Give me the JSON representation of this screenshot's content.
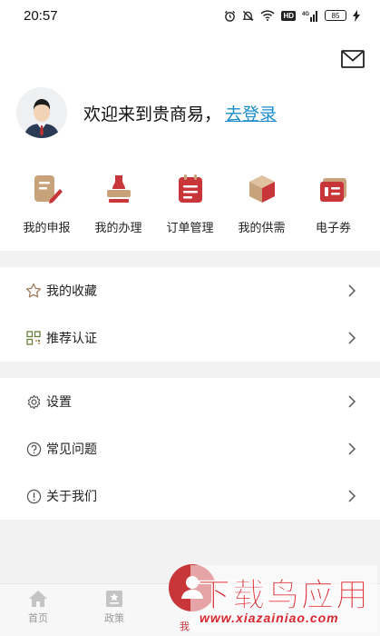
{
  "status_bar": {
    "time": "20:57",
    "hd": "HD",
    "signal": "4G",
    "battery": "85"
  },
  "header": {
    "welcome_text": "欢迎来到贵商易，",
    "login_link": "去登录",
    "mail_icon": "mail-icon",
    "avatar": "avatar-man-icon"
  },
  "quick_actions": [
    {
      "label": "我的申报",
      "icon": "document-edit-icon"
    },
    {
      "label": "我的办理",
      "icon": "stamp-icon"
    },
    {
      "label": "订单管理",
      "icon": "order-list-icon"
    },
    {
      "label": "我的供需",
      "icon": "box-icon"
    },
    {
      "label": "电子券",
      "icon": "ticket-icon"
    }
  ],
  "menu_group_1": [
    {
      "label": "我的收藏",
      "icon": "star-icon"
    },
    {
      "label": "推荐认证",
      "icon": "qr-code-icon"
    }
  ],
  "menu_group_2": [
    {
      "label": "设置",
      "icon": "gear-icon"
    },
    {
      "label": "常见问题",
      "icon": "question-circle-icon"
    },
    {
      "label": "关于我们",
      "icon": "info-circle-icon"
    }
  ],
  "bottom_nav": [
    {
      "label": "首页",
      "icon": "home-icon"
    },
    {
      "label": "政策",
      "icon": "policy-icon"
    },
    {
      "label": "我",
      "icon": "user-icon"
    }
  ],
  "watermark": {
    "title": "下载鸟应用",
    "url": "www.xiazainiao.com"
  },
  "colors": {
    "accent_red": "#c9363a",
    "link_blue": "#1a8ccc",
    "icon_tan": "#c8a27a",
    "separator": "#f2f2f2"
  }
}
